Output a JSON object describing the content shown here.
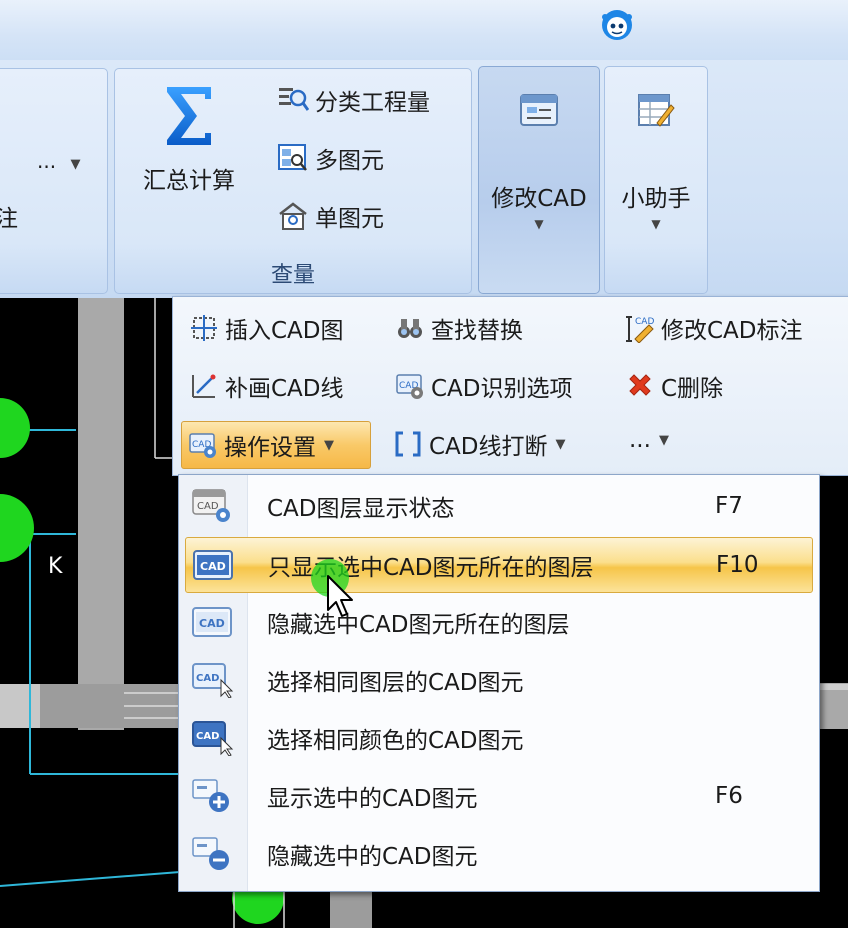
{
  "ribbon": {
    "left_partial": {
      "ellipsis": "...",
      "cut_char": "注"
    },
    "query_group": {
      "label": "查量",
      "sum_button": "汇总计算",
      "category_qty": "分类工程量",
      "multi_element": "多图元",
      "single_element": "单图元"
    },
    "modify_cad": "修改CAD",
    "assistant": "小助手"
  },
  "subbar": {
    "insert_cad": "插入CAD图",
    "find_replace": "查找替换",
    "modify_cad_annotation": "修改CAD标注",
    "redraw_cad_line": "补画CAD线",
    "cad_recognition_options": "CAD识别选项",
    "c_delete": "C删除",
    "operation_settings": "操作设置",
    "cad_line_break": "CAD线打断",
    "more": "..."
  },
  "menu": {
    "items": [
      {
        "label": "CAD图层显示状态",
        "shortcut": "F7",
        "icon": "layer-settings-icon"
      },
      {
        "label": "只显示选中CAD图元所在的图层",
        "shortcut": "F10",
        "icon": "cad-only-icon",
        "highlighted": true
      },
      {
        "label": "隐藏选中CAD图元所在的图层",
        "shortcut": "",
        "icon": "cad-hide-icon"
      },
      {
        "label": "选择相同图层的CAD图元",
        "shortcut": "",
        "icon": "cad-select-layer-icon"
      },
      {
        "label": "选择相同颜色的CAD图元",
        "shortcut": "",
        "icon": "cad-select-color-icon"
      },
      {
        "label": "显示选中的CAD图元",
        "shortcut": "F6",
        "icon": "show-plus-icon"
      },
      {
        "label": "隐藏选中的CAD图元",
        "shortcut": "",
        "icon": "hide-minus-icon"
      }
    ]
  },
  "cad": {
    "label_k": "K"
  },
  "colors": {
    "highlight": "#f6c549",
    "cad_green": "#1fd61f",
    "cad_cyan": "#2fb7d9",
    "ribbon_bg": "#cfe0f5"
  }
}
